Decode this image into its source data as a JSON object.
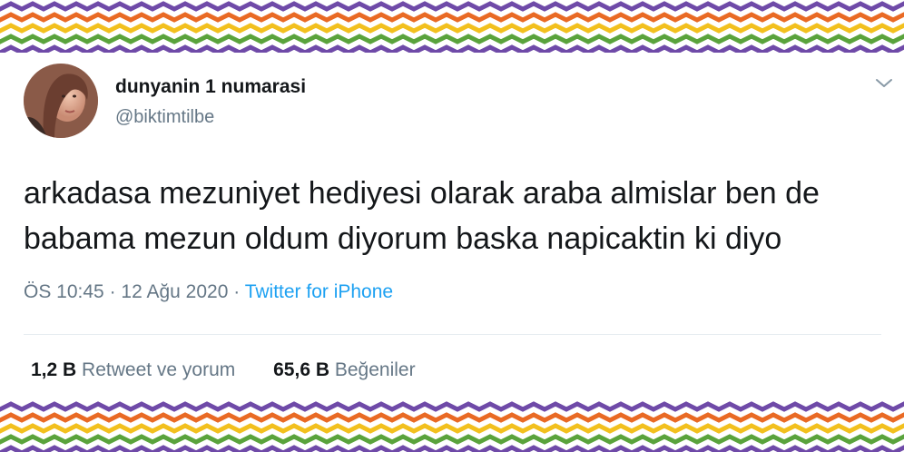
{
  "colors": {
    "text": "#14171a",
    "secondary": "#657786",
    "link": "#1da1f2",
    "chevrons": [
      "#6f4aa8",
      "#e96a24",
      "#f2c01e",
      "#5aa33c"
    ]
  },
  "tweet": {
    "display_name": "dunyanin 1 numarasi",
    "handle": "@biktimtilbe",
    "text_line1": "arkadasa mezuniyet hediyesi olarak araba almislar ben de",
    "text_line2": "babama mezun oldum diyorum baska napicaktin ki diyo",
    "time": "ÖS 10:45",
    "separator": "·",
    "date": "12 Ağu 2020",
    "source": "Twitter for iPhone",
    "retweets_count": "1,2 B",
    "retweets_label": "Retweet ve yorum",
    "likes_count": "65,6 B",
    "likes_label": "Beğeniler"
  },
  "icons": {
    "more": "chevron-down-icon",
    "avatar": "avatar-photo"
  }
}
